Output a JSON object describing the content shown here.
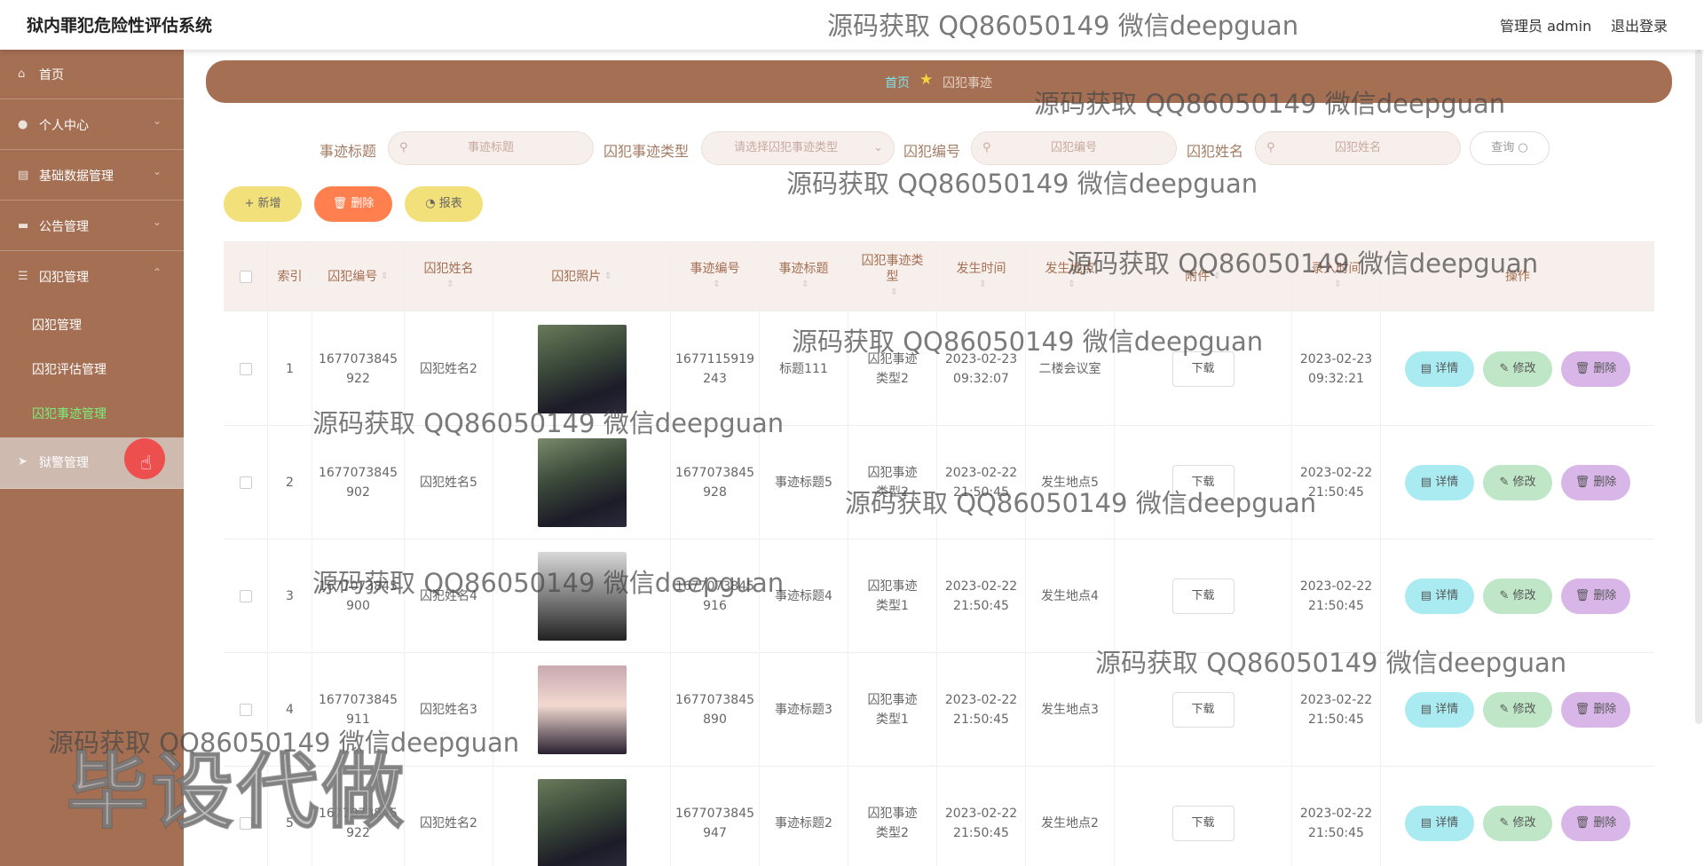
{
  "app": {
    "title": "狱内罪犯危险性评估系统",
    "user": "管理员 admin",
    "logout": "退出登录"
  },
  "sidebar": {
    "items": [
      {
        "label": "首页"
      },
      {
        "label": "个人中心"
      },
      {
        "label": "基础数据管理"
      },
      {
        "label": "公告管理"
      },
      {
        "label": "囚犯管理"
      },
      {
        "label": "狱警管理"
      }
    ],
    "subitems": [
      {
        "label": "囚犯管理"
      },
      {
        "label": "囚犯评估管理"
      },
      {
        "label": "囚犯事迹管理"
      }
    ]
  },
  "breadcrumb": {
    "home": "首页",
    "current": "囚犯事迹"
  },
  "filters": {
    "title_label": "事迹标题",
    "title_placeholder": "事迹标题",
    "type_label": "囚犯事迹类型",
    "type_placeholder": "请选择囚犯事迹类型",
    "no_label": "囚犯编号",
    "no_placeholder": "囚犯编号",
    "name_label": "囚犯姓名",
    "name_placeholder": "囚犯姓名",
    "query": "查询"
  },
  "actions": {
    "add": "+ 新增",
    "delete": "删除",
    "report": "报表"
  },
  "table": {
    "headers": [
      "索引",
      "囚犯编号",
      "囚犯姓名",
      "囚犯照片",
      "事迹编号",
      "事迹标题",
      "囚犯事迹类型",
      "发生时间",
      "发生地点",
      "附件",
      "录入时间",
      "操作"
    ],
    "download": "下载",
    "op_detail": "详情",
    "op_edit": "修改",
    "op_delete": "删除",
    "rows": [
      {
        "index": "1",
        "pno": "1677073845922",
        "name": "囚犯姓名2",
        "eno": "1677115919243",
        "title": "标题111",
        "type": "囚犯事迹类型2",
        "time": "2023-02-23 09:32:07",
        "place": "二楼会议室",
        "created": "2023-02-23 09:32:21"
      },
      {
        "index": "2",
        "pno": "1677073845902",
        "name": "囚犯姓名5",
        "eno": "1677073845928",
        "title": "事迹标题5",
        "type": "囚犯事迹类型2",
        "time": "2023-02-22 21:50:45",
        "place": "发生地点5",
        "created": "2023-02-22 21:50:45"
      },
      {
        "index": "3",
        "pno": "1677073845900",
        "name": "囚犯姓名4",
        "eno": "1677073845916",
        "title": "事迹标题4",
        "type": "囚犯事迹类型1",
        "time": "2023-02-22 21:50:45",
        "place": "发生地点4",
        "created": "2023-02-22 21:50:45"
      },
      {
        "index": "4",
        "pno": "1677073845911",
        "name": "囚犯姓名3",
        "eno": "1677073845890",
        "title": "事迹标题3",
        "type": "囚犯事迹类型1",
        "time": "2023-02-22 21:50:45",
        "place": "发生地点3",
        "created": "2023-02-22 21:50:45"
      },
      {
        "index": "5",
        "pno": "1677073845922",
        "name": "囚犯姓名2",
        "eno": "1677073845947",
        "title": "事迹标题2",
        "type": "囚犯事迹类型2",
        "time": "2023-02-22 21:50:45",
        "place": "发生地点2",
        "created": "2023-02-22 21:50:45"
      }
    ]
  },
  "watermark": {
    "text": "源码获取 QQ86050149 微信deepguan",
    "big": "毕设代做"
  },
  "colors": {
    "primary": "#a46f53",
    "active_sub": "#7cf07a",
    "detail": "#a9ebf0",
    "edit": "#bfe6c6",
    "delete": "#d8b6e8",
    "add": "#f2e07b",
    "remove": "#ff7f4e",
    "report": "#f2e07b"
  }
}
